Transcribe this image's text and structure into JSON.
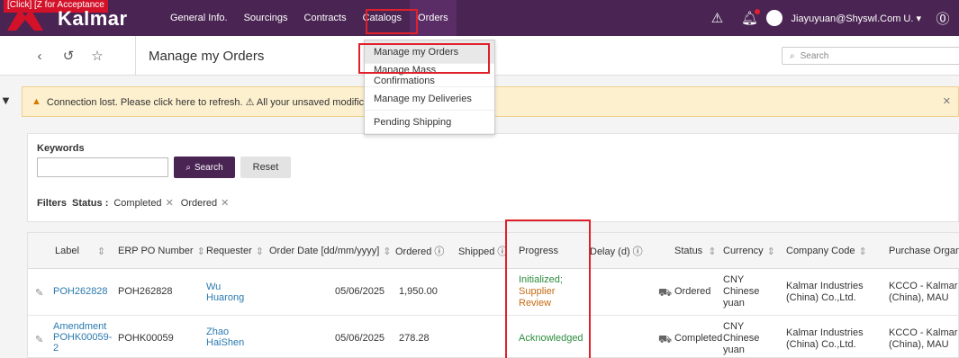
{
  "brand": {
    "click_banner": "[Click] [Z for Acceptance",
    "logo_text": "Kalmar",
    "logo_color": "#d3122a"
  },
  "nav": {
    "items": [
      "General Info.",
      "Sourcings",
      "Contracts",
      "Catalogs",
      "Orders"
    ],
    "active": "Orders"
  },
  "user": {
    "name": "Jiayuyuan@Shyswl.Com U. ▾"
  },
  "subbar": {
    "title": "Manage my Orders",
    "search_placeholder": "Search"
  },
  "dropdown": {
    "items": [
      "Manage my Orders",
      "Manage Mass Confirmations",
      "Manage my Deliveries",
      "Pending Shipping"
    ],
    "selected": "Manage my Orders"
  },
  "warning": {
    "text": "Connection lost. Please click here to refresh. ⚠ All your unsaved modifications wi"
  },
  "filter": {
    "keywords_label": "Keywords",
    "search_button": "Search",
    "reset_button": "Reset",
    "filters_label": "Filters",
    "status_label": "Status :",
    "chips": [
      "Completed",
      "Ordered"
    ]
  },
  "table": {
    "headers": [
      "Label",
      "ERP PO Number",
      "Requester",
      "Order Date [dd/mm/yyyy]",
      "Ordered ⓘ",
      "Shipped ⓘ",
      "Progress",
      "Delay (d) ⓘ",
      "Status",
      "Currency",
      "Company Code",
      "Purchase Organization"
    ],
    "rows": [
      {
        "label": "POH262828",
        "erp": "POH262828",
        "requester_1": "Wu",
        "requester_2": "Huarong",
        "date": "05/06/2025",
        "ordered": "1,950.00",
        "progress_1": "Initialized;",
        "progress_2": "Supplier",
        "progress_3": "Review",
        "status": "Ordered",
        "currency_1": "CNY",
        "currency_2": "Chinese",
        "currency_3": "yuan",
        "company_1": "Kalmar Industries",
        "company_2": "(China) Co.,Ltd.",
        "purch_1": "KCCO - Kalmar Industr",
        "purch_2": "(China), MAU"
      },
      {
        "label_1": "Amendment",
        "label_2": "POHK00059-",
        "label_3": "2",
        "erp": "POHK00059",
        "requester_1": "Zhao",
        "requester_2": "HaiShen",
        "date": "05/06/2025",
        "ordered": "278.28",
        "progress": "Acknowledged",
        "status": "Completed",
        "currency_1": "CNY",
        "currency_2": "Chinese",
        "currency_3": "yuan",
        "company_1": "Kalmar Industries",
        "company_2": "(China) Co.,Ltd.",
        "purch_1": "KCCO - Kalmar Industr",
        "purch_2": "(China), MAU"
      }
    ]
  }
}
